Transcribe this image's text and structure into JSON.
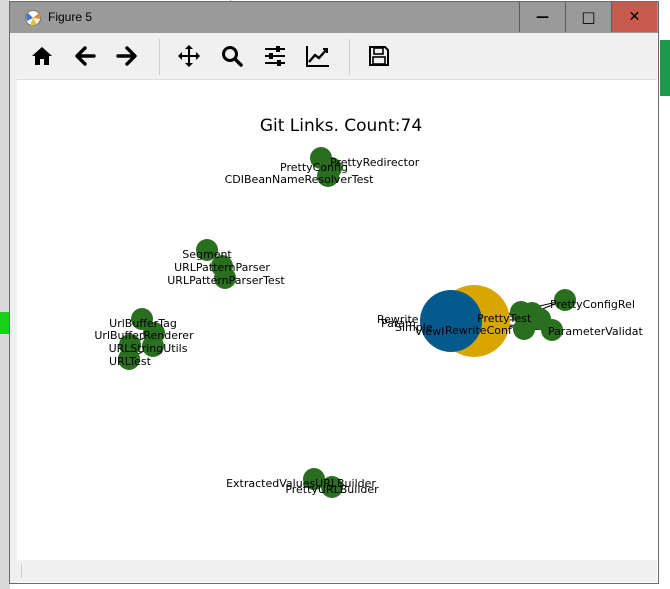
{
  "window": {
    "title": "Figure 5",
    "minimize_glyph": "—",
    "maximize_glyph": "□",
    "close_glyph": "✕"
  },
  "toolbar": {
    "buttons": [
      {
        "name": "home",
        "icon": "home-icon"
      },
      {
        "name": "back",
        "icon": "arrow-left-icon"
      },
      {
        "name": "forward",
        "icon": "arrow-right-icon"
      },
      {
        "name": "pan",
        "icon": "move-icon"
      },
      {
        "name": "zoom",
        "icon": "magnifier-icon"
      },
      {
        "name": "configure-subplots",
        "icon": "sliders-icon"
      },
      {
        "name": "edit-axis",
        "icon": "line-chart-icon"
      },
      {
        "name": "save",
        "icon": "floppy-icon"
      }
    ]
  },
  "chart_data": {
    "type": "network-graph",
    "title": "Git Links. Count:74",
    "colors": {
      "node": "#2a6e1f",
      "hub_blue": "#045a8d",
      "hub_gold": "#d9a600",
      "edge": "#000000"
    },
    "clusters": [
      {
        "labels": [
          "PrettyRedirector",
          "PrettyConfig",
          "CDIBeanNameResolverTest"
        ]
      },
      {
        "labels": [
          "Segment",
          "URLPatternParser",
          "URLPatternParserTest"
        ]
      },
      {
        "labels": [
          "UrlBufferTag",
          "UrlBufferRenderer",
          "URLStringUtils",
          "URLTest"
        ]
      },
      {
        "labels": [
          "ExtractedValuesURLBuilder",
          "PrettyURLBuilder"
        ]
      },
      {
        "labels": [
          "PrettyConfigRel",
          "Rewrite",
          "Param",
          "Simple",
          "ViewI",
          "RewriteConf",
          "PrettyTest",
          "ParameterValidat"
        ]
      }
    ]
  }
}
